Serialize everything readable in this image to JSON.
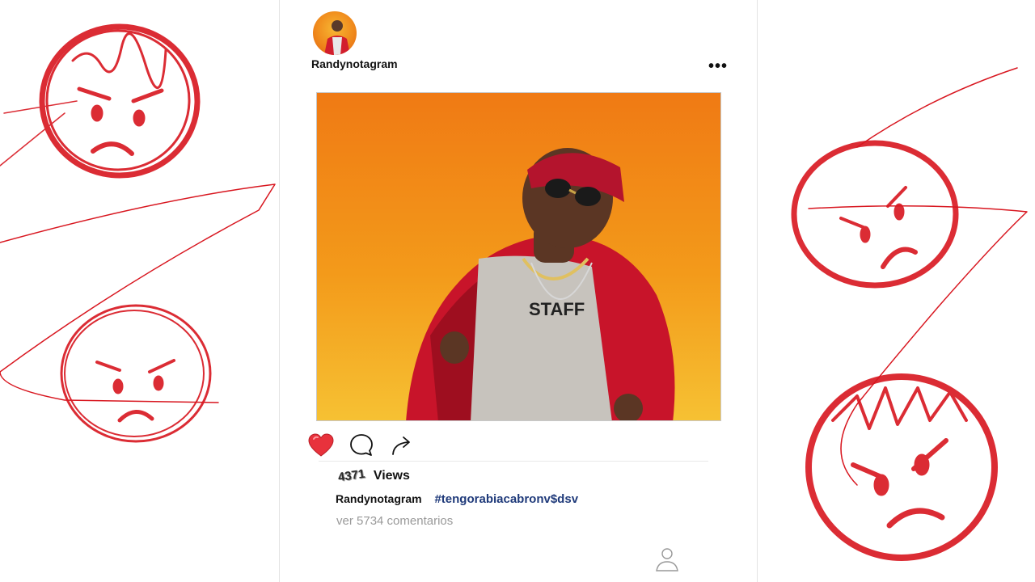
{
  "post": {
    "username": "Randynotagram",
    "more_label": "•••",
    "photo": {
      "description_icon": "man-in-red-jacket-photo",
      "background_colors": [
        "#f07a14",
        "#f6c133"
      ]
    },
    "actions": {
      "like_icon": "heart-icon",
      "like_color": "#e8323c",
      "comment_icon": "comment-icon",
      "share_icon": "share-icon"
    },
    "views_count": "4371",
    "views_label": "Views",
    "caption_user": "Randynotagram",
    "caption_hashtag": "#tengorabiacabronv$dsv",
    "comments_link": "ver 5734 comentarios",
    "profile_icon": "user-icon"
  },
  "decorations": {
    "doodle_color": "#d8161f",
    "faces": [
      "angry-face-icon",
      "angry-face-icon",
      "angry-face-icon",
      "angry-face-icon"
    ]
  }
}
